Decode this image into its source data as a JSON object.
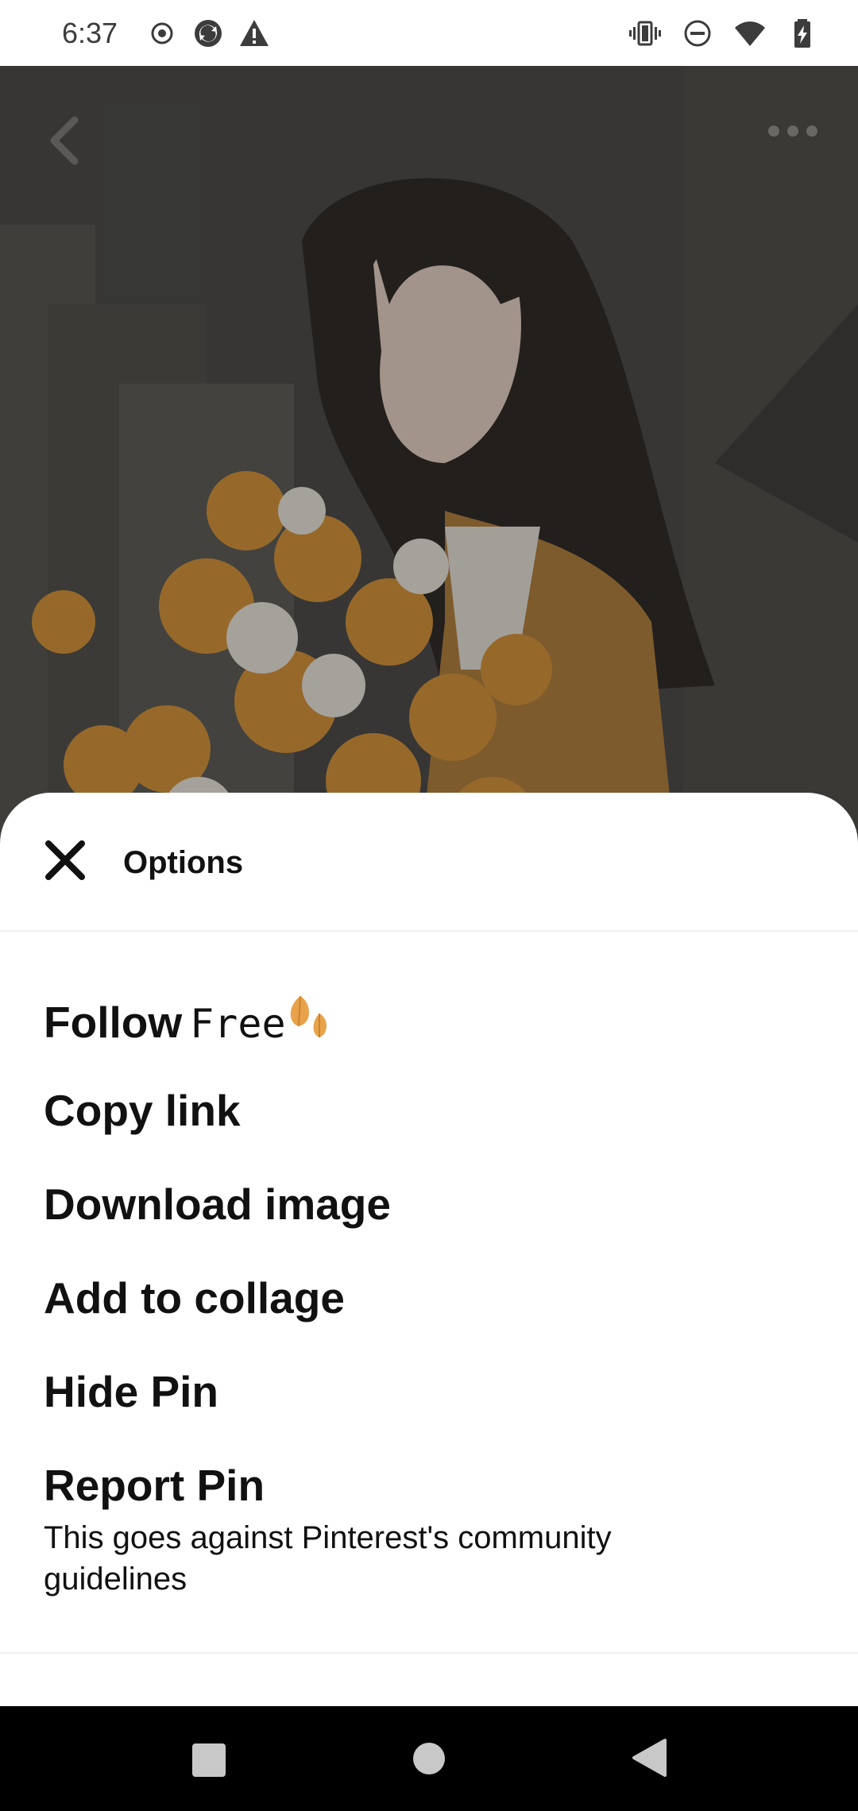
{
  "status_bar": {
    "time": "6:37",
    "left_icons": [
      "record-icon",
      "sync-icon",
      "warning-icon"
    ],
    "right_icons": [
      "vibrate-icon",
      "do-not-disturb-icon",
      "wifi-icon",
      "battery-charging-icon"
    ]
  },
  "pin": {
    "image_subject": "anime-girl-with-flowers",
    "back_icon": "chevron-left-icon",
    "more_icon": "more-horizontal-icon"
  },
  "sheet": {
    "title": "Options",
    "close_icon": "close-icon",
    "options": {
      "follow_label": "Follow",
      "follow_name": "Free",
      "copy_link": "Copy link",
      "download_image": "Download image",
      "add_to_collage": "Add to collage",
      "hide_pin": "Hide Pin",
      "report_pin": "Report Pin",
      "report_pin_sub": "This goes against Pinterest's community guidelines"
    }
  },
  "nav_bar": {
    "icons": [
      "recents-icon",
      "home-icon",
      "back-icon"
    ]
  },
  "colors": {
    "sheet_bg": "#ffffff",
    "text": "#111111",
    "nav_bg": "#000000",
    "leaf": "#e8a34a"
  }
}
